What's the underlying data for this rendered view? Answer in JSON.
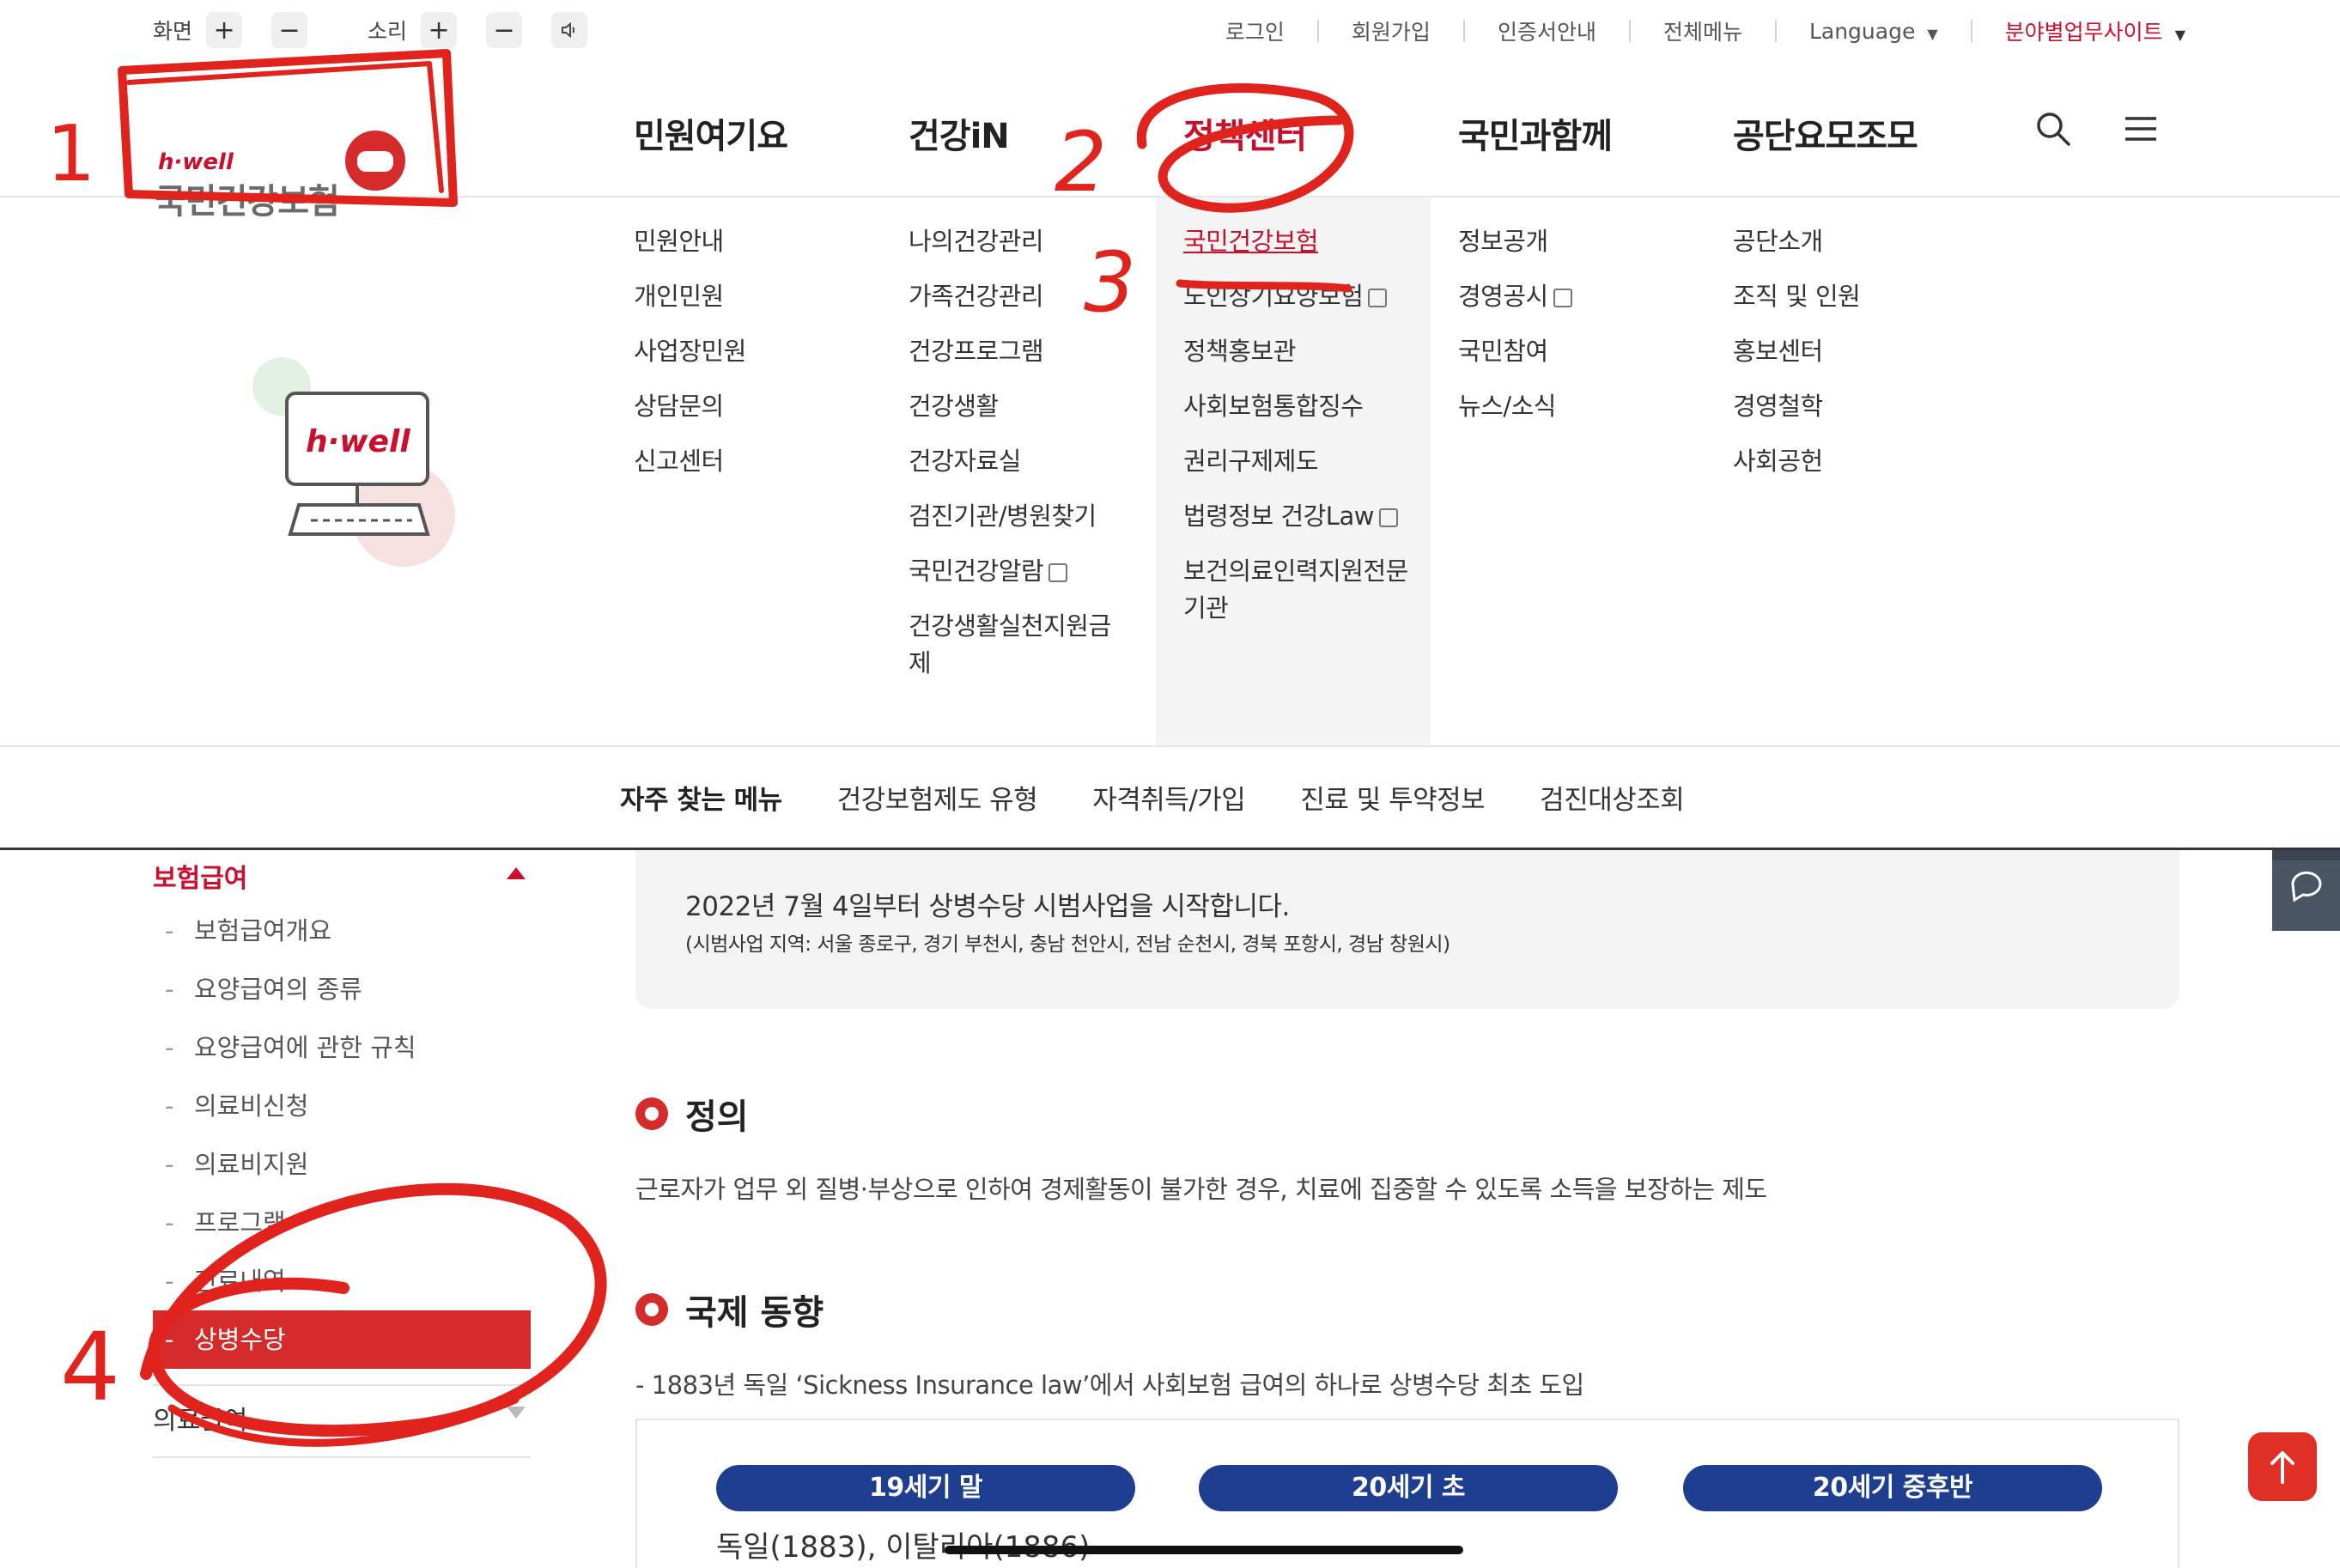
{
  "utility": {
    "screen_label": "화면",
    "sound_label": "소리",
    "plus": "+",
    "minus": "−",
    "links": [
      "로그인",
      "회원가입",
      "인증서안내",
      "전체메뉴"
    ],
    "language": "Language",
    "field_sites": "분야별업무사이트"
  },
  "logo": {
    "brand": "h·well",
    "name": "국민건강보험"
  },
  "gnb": {
    "items": [
      "민원여기요",
      "건강iN",
      "정책센터",
      "국민과함께",
      "공단요모조모"
    ],
    "active_index": 2
  },
  "mega_menu": {
    "columns": [
      [
        "민원안내",
        "개인민원",
        "사업장민원",
        "상담문의",
        "신고센터"
      ],
      [
        "나의건강관리",
        "가족건강관리",
        "건강프로그램",
        "건강생활",
        "건강자료실",
        "검진기관/병원찾기",
        "국민건강알람",
        "건강생활실천지원금제"
      ],
      [
        "국민건강보험",
        "노인장기요양보험",
        "정책홍보관",
        "사회보험통합징수",
        "권리구제제도",
        "법령정보 건강Law",
        "보건의료인력지원전문기관"
      ],
      [
        "정보공개",
        "경영공시",
        "국민참여",
        "뉴스/소식"
      ],
      [
        "공단소개",
        "조직 및 인원",
        "홍보센터",
        "경영철학",
        "사회공헌"
      ]
    ],
    "illustration_text": "h·well"
  },
  "quick_menu": {
    "title": "자주 찾는 메뉴",
    "items": [
      "건강보험제도 유형",
      "자격취득/가입",
      "진료 및 투약정보",
      "검진대상조회"
    ]
  },
  "sidebar": {
    "section": "보험급여",
    "items": [
      "보험급여개요",
      "요양급여의 종류",
      "요양급여에 관한 규칙",
      "의료비신청",
      "의료비지원",
      "프로그램",
      "진료내역",
      "상병수당"
    ],
    "active_index": 7,
    "next_section": "의료급여"
  },
  "notice": {
    "line1": "2022년 7월 4일부터 상병수당 시범사업을 시작합니다.",
    "line2": "(시범사업 지역: 서울 종로구, 경기 부천시, 충남 천안시, 전남 순천시, 경북 포항시, 경남 창원시)"
  },
  "definition": {
    "title": "정의",
    "text": "근로자가 업무 외 질병·부상으로 인하여 경제활동이 불가한 경우, 치료에 집중할 수 있도록 소득을 보장하는 제도"
  },
  "international": {
    "title": "국제 동향",
    "text": "- 1883년 독일 ‘Sickness Insurance law’에서 사회보험 급여의 하나로 상병수당 최초 도입",
    "periods": [
      "19세기 말",
      "20세기 초",
      "20세기 중후반"
    ],
    "first_entry": "독일(1883), 이탈리아(1886)"
  },
  "annotations": [
    "1",
    "2",
    "3",
    "4"
  ],
  "colors": {
    "brand_red": "#c8102e",
    "pill_blue": "#1e3f8f",
    "marker_red": "#e0231c"
  }
}
